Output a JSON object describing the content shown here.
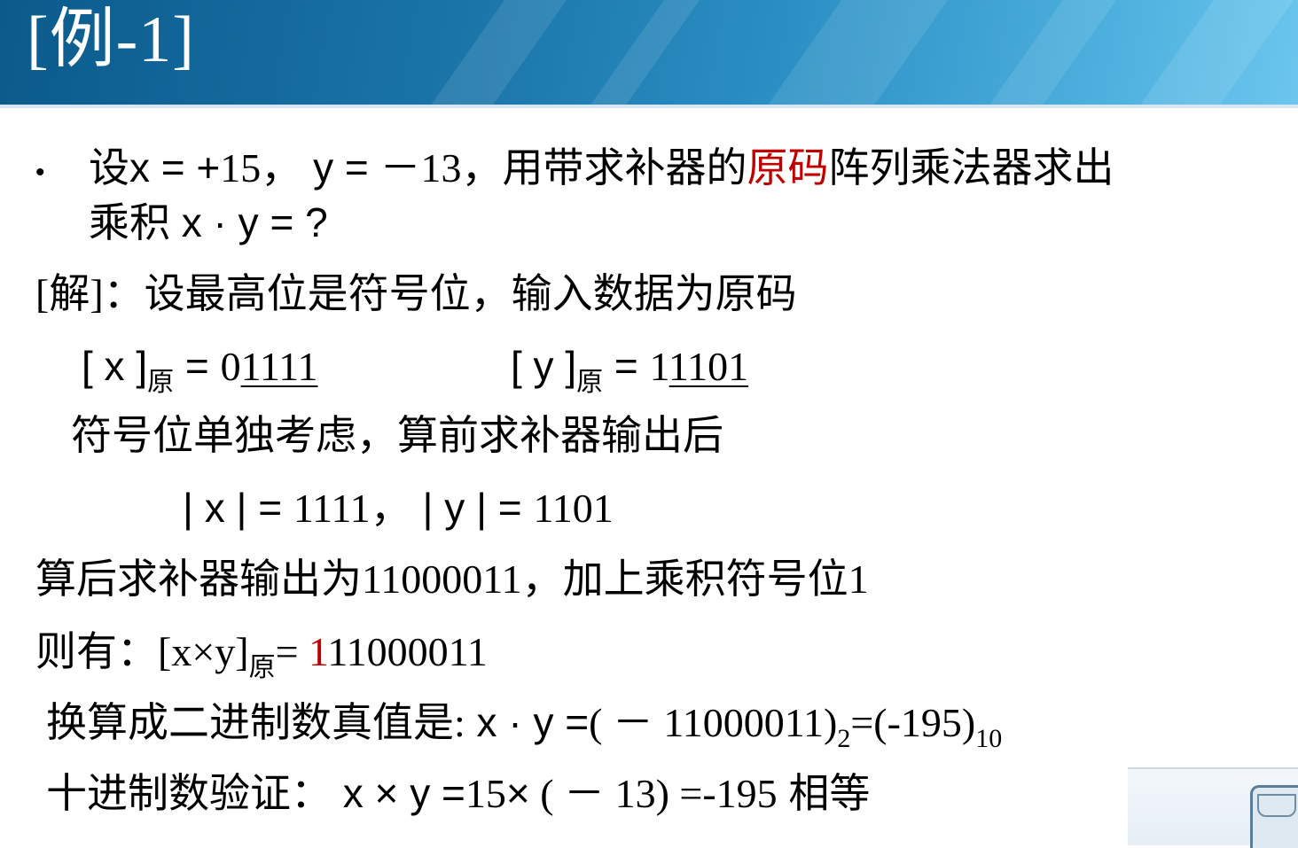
{
  "header": {
    "title": "[例-1]"
  },
  "content": {
    "q_p1": "设",
    "q_p2": "x = +",
    "q_p3": "15",
    "q_p4": "，",
    "q_p5": "y = －",
    "q_p6": "13",
    "q_p7": "，用带求补器的",
    "q_p8": "原码",
    "q_p9": "阵列乘法器求出",
    "q2_p1": "乘积",
    "q2_p2": "x · y = ?",
    "sol_p1": "[",
    "sol_p2": "解",
    "sol_p3": "]",
    "sol_p4": "：设最高位是符号位，输入数据为原码",
    "x_p1": "[ x ]",
    "x_sub": "原",
    "x_p2": " =",
    "x_p3": "0",
    "x_p4": "1111",
    "y_p1": "[ y ]",
    "y_sub": "原",
    "y_p2": " =  ",
    "y_p3": "1",
    "y_p4": "1101",
    "sign_text": "符号位单独考虑，算前求补器输出后",
    "abs_p1": "| x | = ",
    "abs_p2": "1111",
    "abs_p3": "，  | y | = ",
    "abs_p4": "1101",
    "after_p1": "算后求补器输出为",
    "after_p2": "11000011",
    "after_p3": "，加上乘积符号位",
    "after_p4": "1",
    "then_p1": "则有：",
    "then_p2": "[x×y]",
    "then_sub": "原",
    "then_p3": "= ",
    "then_red": "1",
    "then_p4": "11000011",
    "conv_p1": "换算成二进制数真值是",
    "conv_p2": ":",
    "conv_p3": " x · y =",
    "conv_p4": "( －",
    "conv_p5": " 11000011)",
    "conv_sub2": "2",
    "conv_p6": "=(-195)",
    "conv_sub10": "10",
    "ver_p1": "十进制数验证：",
    "ver_p2": " x × y =",
    "ver_p3": "15",
    "ver_p4": "×",
    "ver_p5": " ( －",
    "ver_p6": " 13) =-195",
    "ver_p7": "  相等"
  }
}
